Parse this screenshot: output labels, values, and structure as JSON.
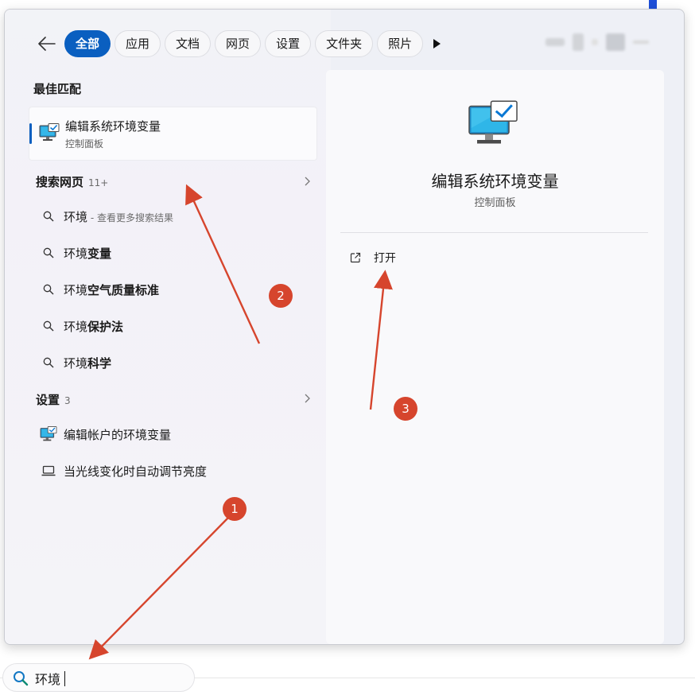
{
  "filters": {
    "back_label": "←",
    "chips": [
      "全部",
      "应用",
      "文档",
      "网页",
      "设置",
      "文件夹",
      "照片"
    ],
    "active_index": 0
  },
  "best_match": {
    "section_title": "最佳匹配",
    "item": {
      "name": "编辑系统环境变量",
      "sub": "控制面板",
      "icon": "monitor-check-icon"
    }
  },
  "web_search": {
    "section_title": "搜索网页",
    "count": "11+",
    "items": [
      {
        "prefix": "环境",
        "bold": "",
        "hint": " - 查看更多搜索结果"
      },
      {
        "prefix": "环境",
        "bold": "变量",
        "hint": ""
      },
      {
        "prefix": "环境",
        "bold": "空气质量标准",
        "hint": ""
      },
      {
        "prefix": "环境",
        "bold": "保护法",
        "hint": ""
      },
      {
        "prefix": "环境",
        "bold": "科学",
        "hint": ""
      }
    ]
  },
  "settings": {
    "section_title": "设置",
    "count": "3",
    "items": [
      {
        "label": "编辑帐户的环境变量",
        "icon": "monitor-check-icon"
      },
      {
        "label": "当光线变化时自动调节亮度",
        "icon": "laptop-icon"
      }
    ]
  },
  "detail": {
    "title": "编辑系统环境变量",
    "subtitle": "控制面板",
    "open_label": "打开"
  },
  "taskbar": {
    "search_value": "环境"
  },
  "annotations": [
    "1",
    "2",
    "3"
  ],
  "colors": {
    "accent": "#0a5fc0",
    "annotation": "#d6452d"
  }
}
